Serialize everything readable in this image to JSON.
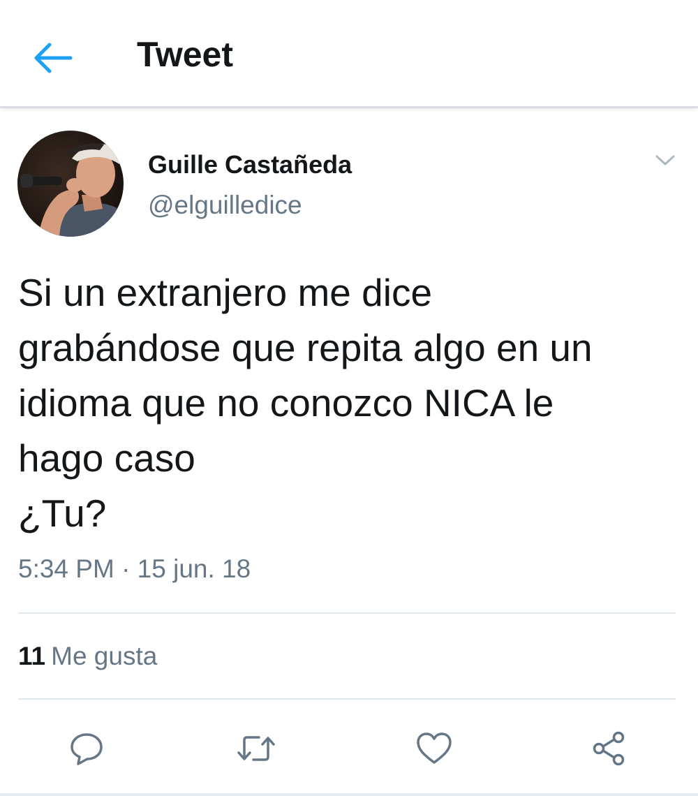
{
  "header": {
    "title": "Tweet",
    "back_icon": "arrow-left-icon",
    "accent_color": "#1da1f2"
  },
  "author": {
    "display_name": "Guille Castañeda",
    "handle": "@elguilledice",
    "avatar_icon": "profile-avatar",
    "menu_icon": "chevron-down-icon"
  },
  "tweet": {
    "text": "Si un extranjero me dice\ngrabándose que repita algo en un\nidioma que no conozco NICA le\nhago caso\n¿Tu?",
    "timestamp": "5:34 PM · 15 jun. 18"
  },
  "stats": {
    "likes_count": "11",
    "likes_label": "Me gusta"
  },
  "actions": [
    {
      "name": "reply",
      "icon": "reply-bubble-icon"
    },
    {
      "name": "retweet",
      "icon": "retweet-icon"
    },
    {
      "name": "like",
      "icon": "heart-icon"
    },
    {
      "name": "share",
      "icon": "share-icon"
    }
  ],
  "colors": {
    "text_primary": "#14171a",
    "text_secondary": "#657786",
    "divider": "#e1e8ed",
    "icon_gray": "#657786"
  }
}
